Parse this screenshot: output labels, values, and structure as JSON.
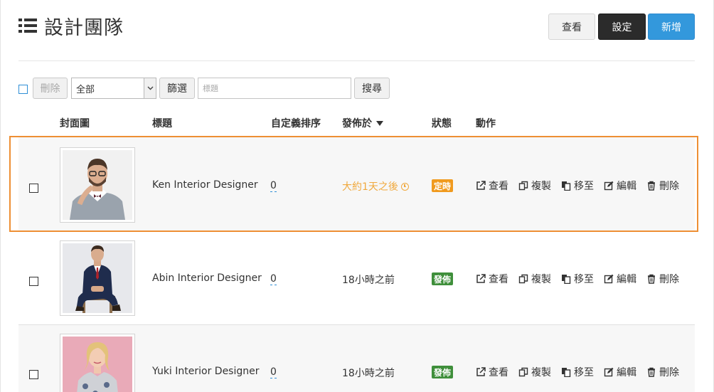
{
  "header": {
    "title": "設計團隊",
    "view_label": "查看",
    "settings_label": "設定",
    "add_label": "新增"
  },
  "toolbar": {
    "delete_label": "刪除",
    "filter_select_value": "全部",
    "filter_label": "篩選",
    "search_placeholder": "標題",
    "search_label": "搜尋"
  },
  "table": {
    "columns": {
      "cover": "封面圖",
      "title": "標題",
      "custom_order": "自定義排序",
      "published_at": "發佈於",
      "status": "狀態",
      "actions": "動作"
    },
    "action_labels": {
      "view": "查看",
      "copy": "複製",
      "move": "移至",
      "edit": "編輯",
      "delete": "刪除"
    },
    "rows": [
      {
        "title": "Ken Interior Designer",
        "order": "0",
        "published": "大約1天之後",
        "status": "定時"
      },
      {
        "title": "Abin Interior Designer",
        "order": "0",
        "published": "18小時之前",
        "status": "發佈"
      },
      {
        "title": "Yuki Interior Designer",
        "order": "0",
        "published": "18小時之前",
        "status": "發佈"
      }
    ]
  },
  "colors": {
    "primary_blue": "#3398dc",
    "dark_button": "#2b2b2b",
    "highlight_orange": "#ee8f34",
    "scheduled_badge": "#f09a1e",
    "published_badge": "#3f8f3b",
    "scheduled_text": "#f0a93e"
  }
}
